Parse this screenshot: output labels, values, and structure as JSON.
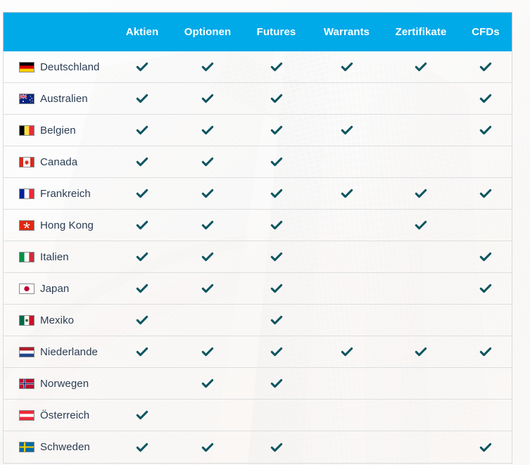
{
  "table": {
    "columns": [
      {
        "key": "country",
        "label": ""
      },
      {
        "key": "aktien",
        "label": "Aktien"
      },
      {
        "key": "optionen",
        "label": "Optionen"
      },
      {
        "key": "futures",
        "label": "Futures"
      },
      {
        "key": "warrants",
        "label": "Warrants"
      },
      {
        "key": "zertifikate",
        "label": "Zertifikate"
      },
      {
        "key": "cfds",
        "label": "CFDs"
      }
    ],
    "header_color": "#00a9e8",
    "header_text_color": "#ffffff",
    "check_color": "#0f5561",
    "country_text_color": "#2b3c52",
    "row_divider_color": "#dcdee0",
    "check_icon": "check-icon",
    "rows": [
      {
        "country": "Deutschland",
        "flag": "flag-de",
        "values": [
          true,
          true,
          true,
          true,
          true,
          true
        ]
      },
      {
        "country": "Australien",
        "flag": "flag-au",
        "values": [
          true,
          true,
          true,
          false,
          false,
          true
        ]
      },
      {
        "country": "Belgien",
        "flag": "flag-be",
        "values": [
          true,
          true,
          true,
          true,
          false,
          true
        ]
      },
      {
        "country": "Canada",
        "flag": "flag-ca",
        "values": [
          true,
          true,
          true,
          false,
          false,
          false
        ]
      },
      {
        "country": "Frankreich",
        "flag": "flag-fr",
        "values": [
          true,
          true,
          true,
          true,
          true,
          true
        ]
      },
      {
        "country": "Hong Kong",
        "flag": "flag-hk",
        "values": [
          true,
          true,
          true,
          false,
          true,
          false
        ]
      },
      {
        "country": "Italien",
        "flag": "flag-it",
        "values": [
          true,
          true,
          true,
          false,
          false,
          true
        ]
      },
      {
        "country": "Japan",
        "flag": "flag-jp",
        "values": [
          true,
          true,
          true,
          false,
          false,
          true
        ]
      },
      {
        "country": "Mexiko",
        "flag": "flag-mx",
        "values": [
          true,
          false,
          true,
          false,
          false,
          false
        ]
      },
      {
        "country": "Niederlande",
        "flag": "flag-nl",
        "values": [
          true,
          true,
          true,
          true,
          true,
          true
        ]
      },
      {
        "country": "Norwegen",
        "flag": "flag-no",
        "values": [
          false,
          true,
          true,
          false,
          false,
          false
        ]
      },
      {
        "country": "Österreich",
        "flag": "flag-at",
        "values": [
          true,
          false,
          false,
          false,
          false,
          false
        ]
      },
      {
        "country": "Schweden",
        "flag": "flag-se",
        "values": [
          true,
          true,
          true,
          false,
          false,
          true
        ]
      }
    ]
  }
}
